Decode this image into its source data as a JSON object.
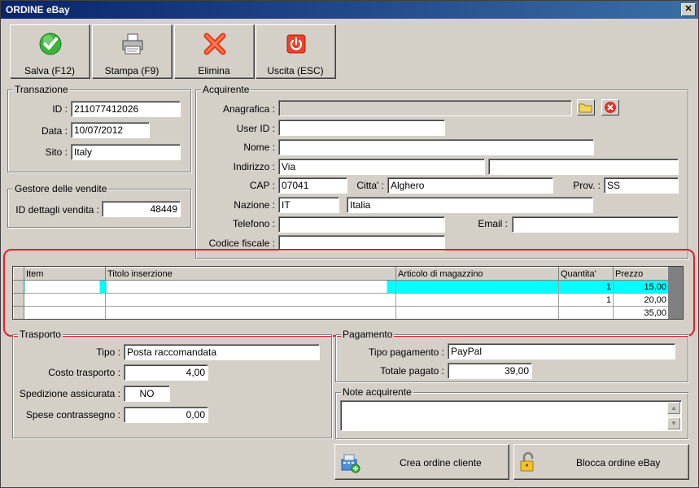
{
  "window": {
    "title": "ORDINE eBay",
    "close_glyph": "✕"
  },
  "toolbar": {
    "save": "Salva (F12)",
    "print": "Stampa (F9)",
    "delete": "Elimina",
    "exit": "Uscita (ESC)"
  },
  "transazione": {
    "legend": "Transazione",
    "id_label": "ID :",
    "id_value": "211077412026",
    "data_label": "Data :",
    "data_value": "10/07/2012",
    "sito_label": "Sito :",
    "sito_value": "Italy"
  },
  "gestore": {
    "legend": "Gestore delle vendite",
    "id_label": "ID dettagli vendita :",
    "id_value": "48449"
  },
  "acquirente": {
    "legend": "Acquirente",
    "anagrafica_label": "Anagrafica :",
    "anagrafica_value": "",
    "userid_label": "User ID :",
    "userid_value": "",
    "nome_label": "Nome :",
    "nome_value": "",
    "indirizzo_label": "Indirizzo :",
    "indirizzo_value": "Via",
    "indirizzo2_value": "",
    "cap_label": "CAP :",
    "cap_value": "07041",
    "citta_label": "Citta' :",
    "citta_value": "Alghero",
    "prov_label": "Prov. :",
    "prov_value": "SS",
    "nazione_label": "Nazione :",
    "nazione_code": "IT",
    "nazione_name": "Italia",
    "telefono_label": "Telefono :",
    "telefono_value": "",
    "email_label": "Email :",
    "email_value": "",
    "cf_label": "Codice fiscale :",
    "cf_value": ""
  },
  "items_grid": {
    "columns": [
      "Item",
      "Titolo inserzione",
      "Articolo di magazzino",
      "Quantita'",
      "Prezzo"
    ],
    "rows": [
      {
        "item": "",
        "titolo": "",
        "articolo": "",
        "quantita": "1",
        "prezzo": "15,00"
      },
      {
        "item": "",
        "titolo": "",
        "articolo": "",
        "quantita": "1",
        "prezzo": "20,00"
      },
      {
        "item": "",
        "titolo": "",
        "articolo": "",
        "quantita": "",
        "prezzo": "35,00"
      }
    ]
  },
  "trasporto": {
    "legend": "Trasporto",
    "tipo_label": "Tipo :",
    "tipo_value": "Posta raccomandata",
    "costo_label": "Costo trasporto :",
    "costo_value": "4,00",
    "assicurata_label": "Spedizione assicurata :",
    "assicurata_value": "NO",
    "contrassegno_label": "Spese contrassegno :",
    "contrassegno_value": "0,00"
  },
  "pagamento": {
    "legend": "Pagamento",
    "tipo_label": "Tipo pagamento :",
    "tipo_value": "PayPal",
    "totale_label": "Totale pagato :",
    "totale_value": "39,00"
  },
  "note": {
    "legend": "Note acquirente",
    "value": ""
  },
  "actions": {
    "crea": "Crea ordine cliente",
    "blocca": "Blocca ordine eBay"
  },
  "icons": {
    "save": "check-icon",
    "print": "printer-icon",
    "delete": "x-icon",
    "exit": "power-icon",
    "folder": "folder-icon",
    "clear": "clear-icon",
    "crea": "cash-register-icon",
    "blocca": "lock-icon"
  },
  "colors": {
    "highlight": "#00ffff",
    "annotation": "#e0202a",
    "titlebar": "#0a246a"
  }
}
